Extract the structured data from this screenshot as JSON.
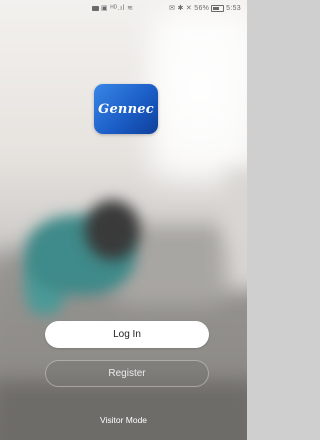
{
  "status_bar": {
    "left_icons": "▣ ᴴᴰ.ıl ≋",
    "right_text": "✉ ✱ ✕ 56%",
    "time": "5:53"
  },
  "app": {
    "logo_text": "Gennec",
    "brand_color": "#1b5ec7"
  },
  "actions": {
    "login_label": "Log In",
    "register_label": "Register",
    "visitor_label": "Visitor Mode"
  }
}
